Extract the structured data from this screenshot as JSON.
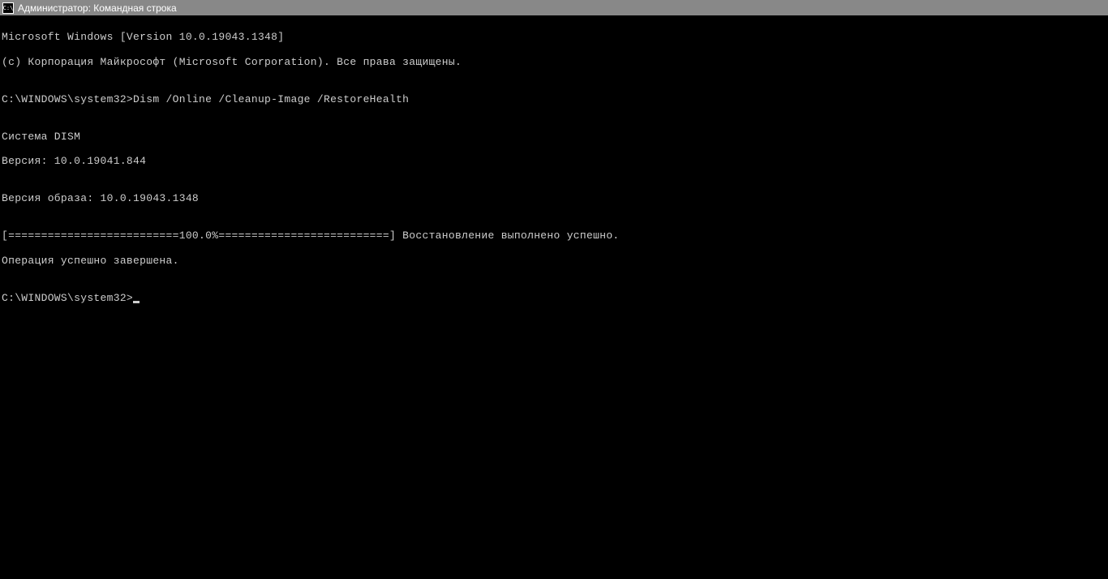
{
  "titlebar": {
    "icon_label": "C:\\",
    "title": "Администратор: Командная строка"
  },
  "terminal": {
    "line1": "Microsoft Windows [Version 10.0.19043.1348]",
    "line2": "(c) Корпорация Майкрософт (Microsoft Corporation). Все права защищены.",
    "blank1": "",
    "prompt1_path": "C:\\WINDOWS\\system32>",
    "prompt1_command": "Dism /Online /Cleanup-Image /RestoreHealth",
    "blank2": "",
    "dism_header": "Cистема DISM",
    "dism_version": "Версия: 10.0.19041.844",
    "blank3": "",
    "image_version": "Версия образа: 10.0.19043.1348",
    "blank4": "",
    "progress_line": "[==========================100.0%==========================] Восстановление выполнено успешно.",
    "completion": "Операция успешно завершена.",
    "blank5": "",
    "prompt2_path": "C:\\WINDOWS\\system32>"
  }
}
